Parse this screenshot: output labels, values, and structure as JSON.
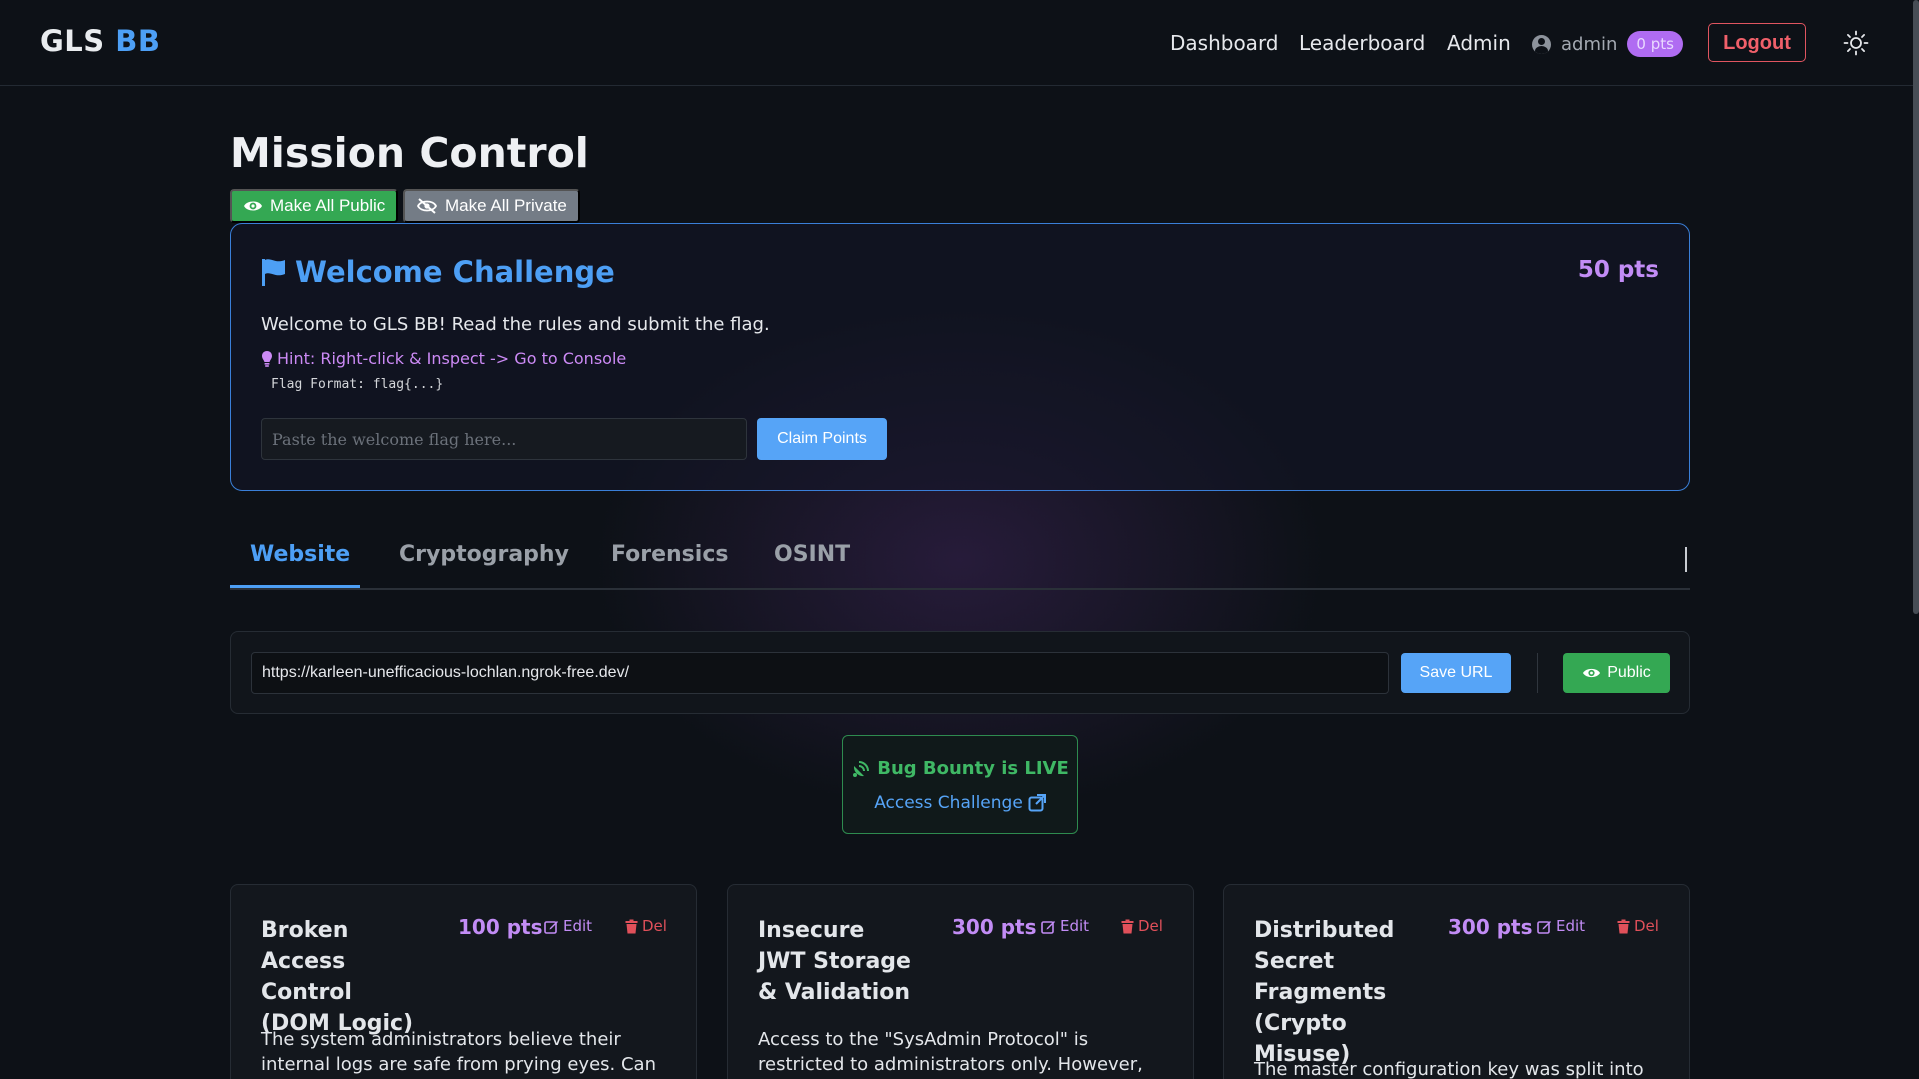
{
  "brand": {
    "part1": "GLS",
    "part2": "BB"
  },
  "nav": {
    "dashboard": "Dashboard",
    "leaderboard": "Leaderboard",
    "admin": "Admin",
    "user_name": "admin",
    "user_points": "0 pts",
    "logout": "Logout",
    "theme_icon": "sun-icon"
  },
  "header": {
    "title": "Mission Control",
    "make_all_public": "Make All Public",
    "make_all_private": "Make All Private"
  },
  "welcome": {
    "title": "Welcome Challenge",
    "points": "50 pts",
    "description": "Welcome to GLS BB! Read the rules and submit the flag.",
    "hint": "Hint: Right-click & Inspect -> Go to Console",
    "flag_format": "Flag Format: flag{...}",
    "input_placeholder": "Paste the welcome flag here...",
    "claim_button": "Claim Points"
  },
  "tabs": [
    {
      "label": "Website",
      "active": true
    },
    {
      "label": "Cryptography",
      "active": false
    },
    {
      "label": "Forensics",
      "active": false
    },
    {
      "label": "OSINT",
      "active": false
    }
  ],
  "url_bar": {
    "value": "https://karleen-unefficacious-lochlan.ngrok-free.dev/",
    "save_button": "Save URL",
    "visibility_button": "Public"
  },
  "live": {
    "title": "Bug Bounty is LIVE",
    "link": "Access Challenge"
  },
  "challenges": [
    {
      "title": "Broken Access Control (DOM Logic)",
      "points": "100 pts",
      "edit": "Edit",
      "delete": "Del",
      "description": "The system administrators believe their internal logs are safe from prying eyes. Can"
    },
    {
      "title": "Insecure JWT Storage & Validation",
      "points": "300 pts",
      "edit": "Edit",
      "delete": "Del",
      "description": "Access to the \"SysAdmin Protocol\" is restricted to administrators only. However,"
    },
    {
      "title": "Distributed Secret Fragments (Crypto Misuse)",
      "points": "300 pts",
      "edit": "Edit",
      "delete": "Del",
      "description": "The master configuration key was split into"
    }
  ],
  "colors": {
    "accent_blue": "#4d9ff5",
    "accent_purple": "#c28cf5",
    "success_green": "#34a853",
    "danger_red": "#e0505a",
    "background": "#0d1117"
  }
}
